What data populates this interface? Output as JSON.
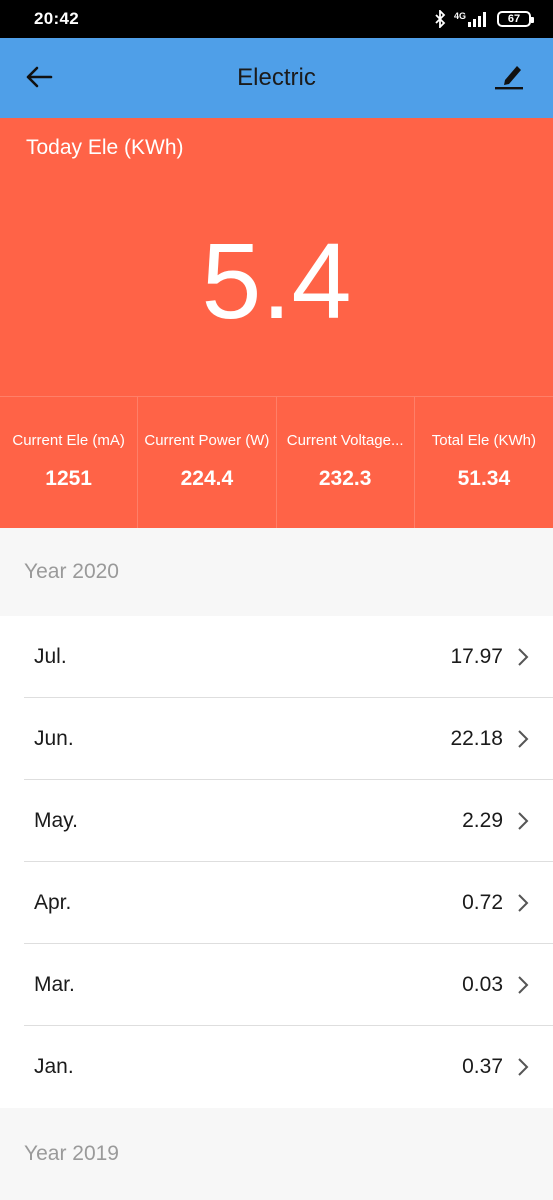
{
  "status_bar": {
    "time": "20:42",
    "network": "4G",
    "battery": "67"
  },
  "app_bar": {
    "title": "Electric",
    "back_icon": "arrow-left-icon",
    "edit_icon": "pencil-edit-icon"
  },
  "hero": {
    "label": "Today Ele (KWh)",
    "value": "5.4"
  },
  "stats": [
    {
      "label": "Current Ele (mA)",
      "value": "1251"
    },
    {
      "label": "Current Power (W)",
      "value": "224.4"
    },
    {
      "label": "Current Voltage...",
      "value": "232.3"
    },
    {
      "label": "Total Ele (KWh)",
      "value": "51.34"
    }
  ],
  "sections": [
    {
      "year_label": "Year 2020"
    },
    {
      "year_label": "Year 2019"
    }
  ],
  "months": [
    {
      "name": "Jul.",
      "value": "17.97"
    },
    {
      "name": "Jun.",
      "value": "22.18"
    },
    {
      "name": "May.",
      "value": "2.29"
    },
    {
      "name": "Apr.",
      "value": "0.72"
    },
    {
      "name": "Mar.",
      "value": "0.03"
    },
    {
      "name": "Jan.",
      "value": "0.37"
    }
  ],
  "colors": {
    "app_bar": "#4f9fe8",
    "hero": "#ff6347"
  }
}
